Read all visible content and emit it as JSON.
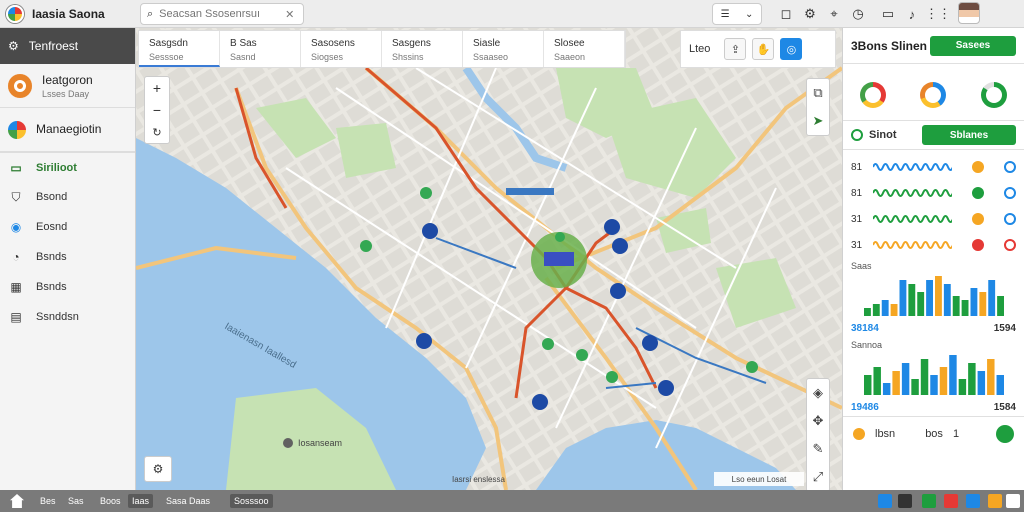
{
  "app": {
    "title": "Iaasia Saona"
  },
  "search": {
    "placeholder": "Seacsan Ssosenrsuı"
  },
  "sidebar": {
    "header": "Tenfroest",
    "cards": [
      {
        "title": "Ieatgoron",
        "subtitle": "Lsses Daay"
      },
      {
        "title": "Manaegiotin",
        "subtitle": ""
      }
    ],
    "items": [
      {
        "label": "Sirilioot",
        "icon": "layers-icon"
      },
      {
        "label": "Bsond",
        "icon": "bookmark-icon"
      },
      {
        "label": "Eosnd",
        "icon": "globe-icon"
      },
      {
        "label": "Bsnds",
        "icon": "clock-icon"
      },
      {
        "label": "Bsnds",
        "icon": "grid-icon"
      },
      {
        "label": "Ssnddsn",
        "icon": "chart-icon"
      }
    ]
  },
  "map_tabs": [
    {
      "title": "Sasgsdn",
      "subtitle": "Sesssoe"
    },
    {
      "title": "B Sas",
      "subtitle": "Sasnd"
    },
    {
      "title": "Sasosens",
      "subtitle": "Siogses"
    },
    {
      "title": "Sasgens",
      "subtitle": "Shssins"
    },
    {
      "title": "Siasle",
      "subtitle": "Ssaaseo"
    },
    {
      "title": "Slosee",
      "subtitle": "Saaeon"
    }
  ],
  "map_toolbar": {
    "label": "Lteo"
  },
  "map": {
    "water_label": "Iaaienasn Iaallesd",
    "park_label": "Iosanseam",
    "street_label": "Iasrsi enslessa",
    "scale_label": "Lso eeun Losat"
  },
  "right_panel": {
    "title": "3Bons Slinen",
    "head_button": "Sasees",
    "section_label": "Sinot",
    "section_button": "Sblanes",
    "spark_rows": [
      {
        "label": "81"
      },
      {
        "label": "81"
      },
      {
        "label": "31"
      },
      {
        "label": "31"
      }
    ],
    "chart1": {
      "title": "Saas",
      "values": [
        2,
        3,
        4,
        3,
        9,
        8,
        6,
        9,
        10,
        8,
        5,
        4,
        7,
        6,
        9,
        5
      ],
      "left_value": "38184",
      "right_value": "1594"
    },
    "chart2": {
      "title": "Sannoa",
      "values": [
        5,
        7,
        3,
        6,
        8,
        4,
        9,
        5,
        7,
        10,
        4,
        8,
        6,
        9,
        5
      ],
      "left_value": "19486",
      "right_value": "1584"
    },
    "footer_values": [
      "lbsn",
      "bos",
      "1"
    ],
    "colors": {
      "green": "#1e9e3e",
      "blue": "#1e88e5",
      "orange": "#f5a623"
    }
  },
  "bottom_bar": {
    "items": [
      "Bes",
      "Sas",
      "Boos",
      "Iaas",
      "Sasa Daas",
      "Sosssoo"
    ]
  }
}
